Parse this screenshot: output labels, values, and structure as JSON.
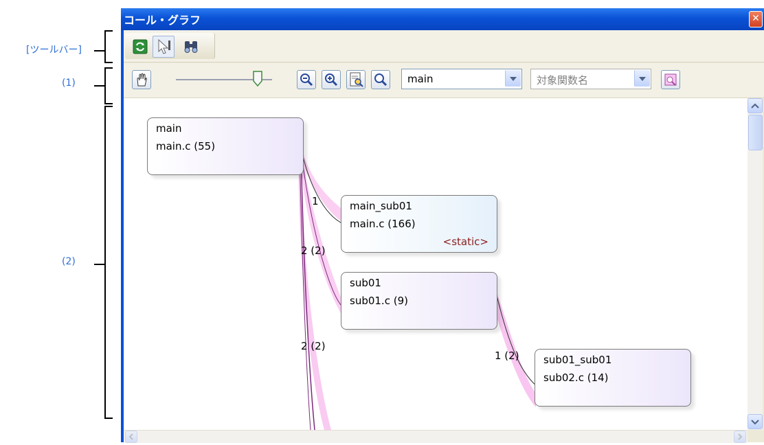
{
  "annotations": {
    "toolbar": "[ツールバー]",
    "area1": "(1)",
    "area2": "(2)"
  },
  "window": {
    "title": "コール・グラフ",
    "close_label": "✕"
  },
  "toolbar": {
    "buttons": [
      "refresh-icon",
      "cursor-icon",
      "binoculars-icon"
    ]
  },
  "controls": {
    "pan_icon": "hand-icon",
    "zoom_slider_level": 0.85,
    "function_combo_value": "main",
    "target_combo_placeholder": "対象関数名",
    "icons": [
      "zoom-out-icon",
      "zoom-in-icon",
      "fit-icon",
      "search-icon",
      "highlight-icon"
    ]
  },
  "graph": {
    "nodes": [
      {
        "id": "main",
        "name": "main",
        "file": "main.c (55)",
        "tag": ""
      },
      {
        "id": "main_sub01",
        "name": "main_sub01",
        "file": "main.c (166)",
        "tag": "<static>"
      },
      {
        "id": "sub01",
        "name": "sub01",
        "file": "sub01.c (9)",
        "tag": ""
      },
      {
        "id": "sub01_sub01",
        "name": "sub01_sub01",
        "file": "sub02.c (14)",
        "tag": ""
      }
    ],
    "edge_labels": [
      "1",
      "2 (2)",
      "2 (2)",
      "1 (2)"
    ]
  },
  "colors": {
    "title_bar": "#0a52d6",
    "accent": "#2e6fd6",
    "edge_band": "#f5a8e8",
    "static_tag": "#8b1d1d"
  }
}
